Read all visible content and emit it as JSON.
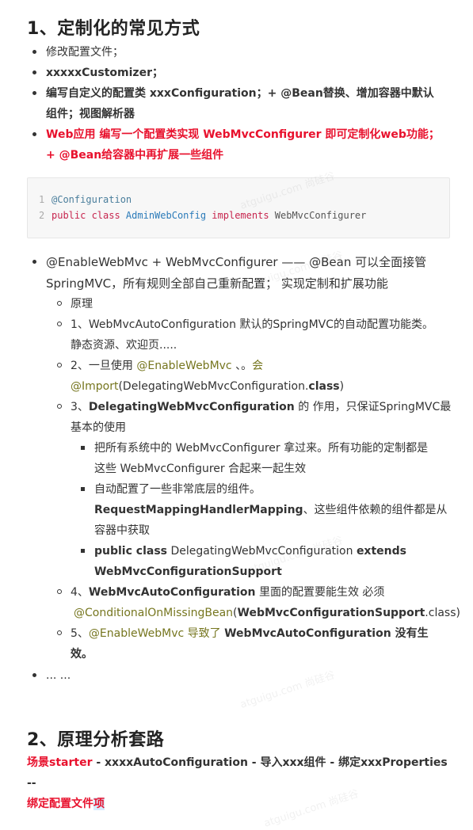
{
  "section1": {
    "title": "1、定制化的常见方式",
    "bullets": [
      "修改配置文件；",
      "xxxxxCustomizer；",
      "编写自定义的配置类   xxxConfiguration；+ @Bean替换、增加容器中默认",
      "组件；视图解析器",
      "Web应用 编写一个配置类实现 WebMvcConfigurer 即可定制化web功能；",
      "+ @Bean给容器中再扩展一些组件"
    ]
  },
  "code": {
    "line_numbers": [
      "1",
      "2"
    ],
    "line1": "@Configuration",
    "line2_kw1": "public class ",
    "line2_cls": "AdminWebConfig",
    "line2_kw2": " implements ",
    "line2_iface": "WebMvcConfigurer"
  },
  "enable": {
    "line1a": "@EnableWebMvc + WebMvcConfigurer —— @Bean  可以全面接管",
    "line1b": "SpringMVC，所有规则全部自己重新配置； 实现定制和扩展功能",
    "sub": {
      "s0": "原理",
      "s1a": "1、WebMvcAutoConfiguration  默认的SpringMVC的自动配置功能类。",
      "s1b": "静态资源、欢迎页.....",
      "s2a_prefix": "2、一旦使用 ",
      "s2a_ann": "@EnableWebMvc",
      "s2a_mid": " 、。",
      "s2a_hui": "会",
      "s2b_ann": "@Import",
      "s2b_paren": "(DelegatingWebMvcConfiguration.",
      "s2b_bold": "class",
      "s2b_end": ")",
      "s3a_prefix": "3、",
      "s3a_bold": "DelegatingWebMvcConfiguration",
      "s3a_rest": " 的 作用，只保证SpringMVC最",
      "s3b": "基本的使用",
      "sq1a": "把所有系统中的 WebMvcConfigurer 拿过来。所有功能的定制都是",
      "sq1b": "这些 WebMvcConfigurer  合起来一起生效",
      "sq2a": "自动配置了一些非常底层的组件。",
      "sq2b_bold": "RequestMappingHandlerMapping",
      "sq2b_rest": "、这些组件依赖的组件都是从",
      "sq2c": "容器中获取",
      "sq3a_bold1": "public class",
      "sq3a_mid": " DelegatingWebMvcConfiguration ",
      "sq3a_bold2": "extends",
      "sq3b_bold": "WebMvcConfigurationSupport",
      "s4a_prefix": "4、",
      "s4a_bold": "WebMvcAutoConfiguration",
      "s4a_rest": " 里面的配置要能生效 必须",
      "s4b_ann": "@ConditionalOnMissingBean",
      "s4b_paren": "(",
      "s4b_bold": "WebMvcConfigurationSupport",
      "s4b_cls": ".class",
      "s4b_end": ")",
      "s5a_prefix": "5、",
      "s5a_ann": "@EnableWebMvc",
      "s5a_mid": "  导致了 ",
      "s5a_bold": "WebMvcAutoConfiguration",
      "s5a_bold2": "  没有生",
      "s5b_bold": "效。"
    },
    "ellipsis": "... ..."
  },
  "section2": {
    "title": "2、原理分析套路",
    "line1_red": "场景starter",
    "line1_rest": " - xxxxAutoConfiguration - 导入xxx组件 - 绑定xxxProperties --",
    "line2_red": "绑定配置文件",
    "line2_sel": "项"
  },
  "watermark": "atguigu.com 尚硅谷"
}
